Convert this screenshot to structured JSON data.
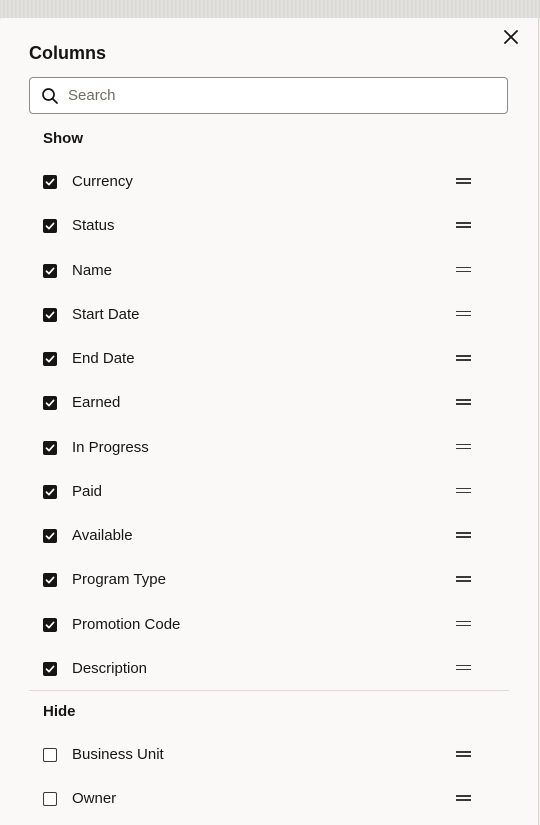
{
  "panel": {
    "title": "Columns",
    "close_label": "Close"
  },
  "search": {
    "value": "",
    "placeholder": "Search"
  },
  "show": {
    "label": "Show",
    "items": [
      {
        "label": "Currency",
        "checked": true
      },
      {
        "label": "Status",
        "checked": true
      },
      {
        "label": "Name",
        "checked": true
      },
      {
        "label": "Start Date",
        "checked": true
      },
      {
        "label": "End Date",
        "checked": true
      },
      {
        "label": "Earned",
        "checked": true
      },
      {
        "label": "In Progress",
        "checked": true
      },
      {
        "label": "Paid",
        "checked": true
      },
      {
        "label": "Available",
        "checked": true
      },
      {
        "label": "Program Type",
        "checked": true
      },
      {
        "label": "Promotion Code",
        "checked": true
      },
      {
        "label": "Description",
        "checked": true
      }
    ]
  },
  "hide": {
    "label": "Hide",
    "items": [
      {
        "label": "Business Unit",
        "checked": false
      },
      {
        "label": "Owner",
        "checked": false
      }
    ]
  },
  "colors": {
    "text": "#161513",
    "panel_bg": "#fbf9f8",
    "checkbox_checked": "#161513",
    "border": "#8e8b86"
  },
  "icons": {
    "close": "close-icon",
    "search": "search-icon",
    "check": "check-icon",
    "drag": "drag-handle-icon"
  }
}
